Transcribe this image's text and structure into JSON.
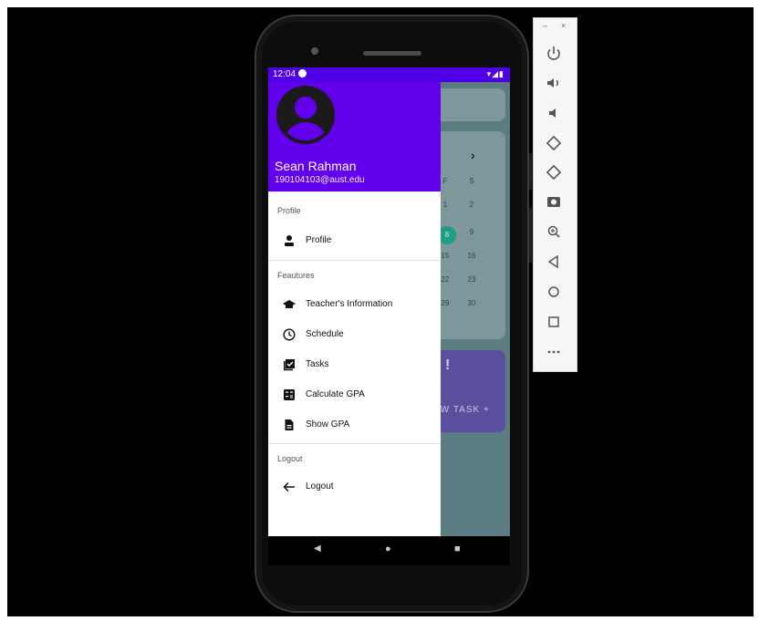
{
  "status_bar": {
    "time": "12:04"
  },
  "drawer": {
    "header": {
      "name": "Sean Rahman",
      "email": "190104103@aust.edu"
    },
    "sections": [
      {
        "title": "Profile",
        "items": [
          {
            "label": "Profile",
            "icon": "person-icon"
          }
        ]
      },
      {
        "title": "Feautures",
        "items": [
          {
            "label": "Teacher's Information",
            "icon": "school-icon"
          },
          {
            "label": "Schedule",
            "icon": "clock-icon"
          },
          {
            "label": "Tasks",
            "icon": "checklist-icon"
          },
          {
            "label": "Calculate GPA",
            "icon": "calculator-icon"
          },
          {
            "label": "Show GPA",
            "icon": "document-icon"
          }
        ]
      },
      {
        "title": "Logout",
        "items": [
          {
            "label": "Logout",
            "icon": "back-arrow-icon"
          }
        ]
      }
    ]
  },
  "background_app": {
    "calendar": {
      "weekday_labels": [
        "F",
        "S"
      ],
      "rows": [
        [
          "1",
          "2"
        ],
        [
          "8",
          "9"
        ],
        [
          "15",
          "16"
        ],
        [
          "22",
          "23"
        ],
        [
          "29",
          "30"
        ]
      ],
      "selected": "8"
    },
    "task_card": {
      "mark": "!",
      "button_text": "OW TASK +"
    }
  },
  "colors": {
    "primary": "#6200ee",
    "status_bar": "#5000e6",
    "selected_day": "#1f9e86"
  }
}
